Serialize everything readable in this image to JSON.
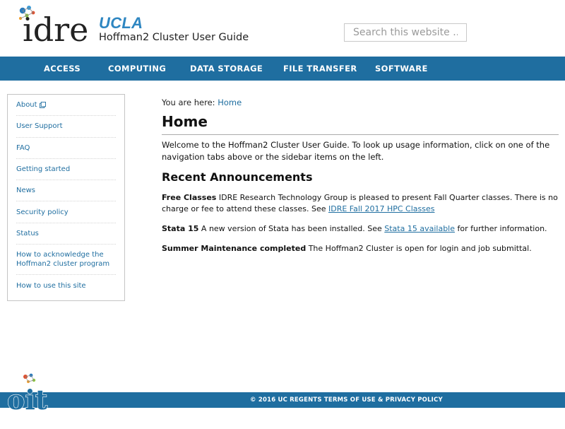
{
  "header": {
    "logo_text": "idre",
    "brand": "UCLA",
    "subtitle": "Hoffman2 Cluster User Guide",
    "search_placeholder": "Search this website .."
  },
  "nav": {
    "items": [
      {
        "label": "ACCESS"
      },
      {
        "label": "COMPUTING"
      },
      {
        "label": "DATA STORAGE"
      },
      {
        "label": "FILE TRANSFER"
      },
      {
        "label": "SOFTWARE"
      }
    ]
  },
  "sidebar": {
    "items": [
      {
        "label": "About"
      },
      {
        "label": "User Support"
      },
      {
        "label": "FAQ"
      },
      {
        "label": "Getting started"
      },
      {
        "label": "News"
      },
      {
        "label": "Security policy"
      },
      {
        "label": "Status"
      },
      {
        "label": "How to acknowledge the Hoffman2 cluster program"
      },
      {
        "label": "How to use this site"
      }
    ]
  },
  "main": {
    "breadcrumb_prefix": "You are here:",
    "breadcrumb_link": "Home",
    "title": "Home",
    "intro": "Welcome to the Hoffman2 Cluster User Guide. To look up usage information, click on one of the navigation tabs above or the sidebar items on the left.",
    "announcements_title": "Recent Announcements",
    "announcements": [
      {
        "heading": "Free Classes",
        "text": " IDRE Research Technology Group is pleased to present Fall Quarter classes. There is no charge or fee to attend these classes. See ",
        "link": "IDRE Fall 2017 HPC Classes",
        "after": ""
      },
      {
        "heading": "Stata 15",
        "text": " A new version of Stata has been installed. See ",
        "link": "Stata 15 available",
        "after": " for further information."
      },
      {
        "heading": "Summer Maintenance completed",
        "text": " The Hoffman2 Cluster is open for login and job submittal.",
        "link": "",
        "after": ""
      }
    ]
  },
  "footer": {
    "logo_text": "oit",
    "text": "© 2016 UC REGENTS TERMS OF USE & PRIVACY POLICY"
  },
  "colors": {
    "nav_bg": "#1f6ea0",
    "brand_blue": "#2e86c1",
    "link": "#1f6ea0"
  }
}
